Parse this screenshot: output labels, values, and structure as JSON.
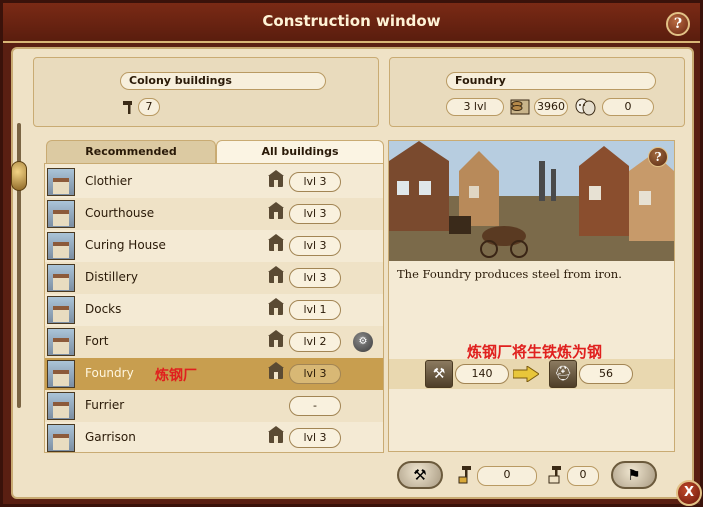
{
  "window": {
    "title": "Construction window",
    "help": "?",
    "close": "X"
  },
  "colony": {
    "label": "Colony buildings",
    "count": "7"
  },
  "selected": {
    "label": "Foundry",
    "level": "3 lvl",
    "cost": "3960",
    "culture": "0"
  },
  "tabs": {
    "recommended": "Recommended",
    "all": "All buildings"
  },
  "buildings": [
    {
      "name": "Clothier",
      "level": "lvl 3"
    },
    {
      "name": "Courthouse",
      "level": "lvl 3"
    },
    {
      "name": "Curing House",
      "level": "lvl 3"
    },
    {
      "name": "Distillery",
      "level": "lvl 3"
    },
    {
      "name": "Docks",
      "level": "lvl 1"
    },
    {
      "name": "Fort",
      "level": "lvl 2"
    },
    {
      "name": "Foundry",
      "level": "lvl 3"
    },
    {
      "name": "Furrier",
      "level": "-"
    },
    {
      "name": "Garrison",
      "level": "lvl 3"
    }
  ],
  "annotation_row": "炼钢厂",
  "annotation_detail": "炼钢厂将生铁炼为钢",
  "detail": {
    "help": "?",
    "description": "The Foundry produces steel from iron.",
    "input_amount": "140",
    "output_amount": "56"
  },
  "footer": {
    "value_a": "0",
    "value_b": "0"
  },
  "icons": {
    "hammer": "hammer-icon",
    "money": "coins-icon",
    "culture": "theatre-masks-icon",
    "iron": "iron-anvil-icon",
    "steel": "steel-helmet-icon"
  },
  "colors": {
    "frame": "#5a1f12",
    "panel": "#efe2c6",
    "accent": "#c89e4f",
    "annotation": "#e0201e"
  }
}
